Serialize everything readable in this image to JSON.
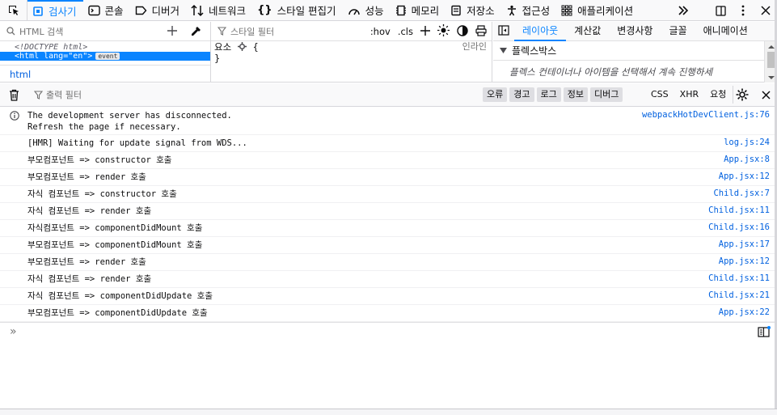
{
  "toolbar": {
    "tabs": [
      {
        "label": "검사기",
        "icon": "inspector-icon"
      },
      {
        "label": "콘솔",
        "icon": "console-icon"
      },
      {
        "label": "디버거",
        "icon": "debugger-icon"
      },
      {
        "label": "네트워크",
        "icon": "network-icon"
      },
      {
        "label": "스타일 편집기",
        "icon": "style-editor-icon"
      },
      {
        "label": "성능",
        "icon": "performance-icon"
      },
      {
        "label": "메모리",
        "icon": "memory-icon"
      },
      {
        "label": "저장소",
        "icon": "storage-icon"
      },
      {
        "label": "접근성",
        "icon": "accessibility-icon"
      },
      {
        "label": "애플리케이션",
        "icon": "application-icon"
      }
    ],
    "selected_tab": "검사기",
    "accent": "#0a84ff"
  },
  "markup": {
    "search_placeholder": "HTML 검색",
    "doctype": "<!DOCTYPE html>",
    "selected_node": "<html lang=\"en\">",
    "selected_badge": "event",
    "breadcrumb": "html"
  },
  "rules": {
    "filter_placeholder": "스타일 필터",
    "hov": ":hov",
    "cls": ".cls",
    "selector_line": "요소",
    "open_brace": "{",
    "close_brace": "}",
    "source": "인라인"
  },
  "layout": {
    "tabs": [
      "레이아웃",
      "계산값",
      "변경사항",
      "글꼴",
      "애니메이션"
    ],
    "selected_tab": "레이아웃",
    "flex_header": "플렉스박스",
    "flex_message": "플렉스 컨테이너나 아이템을 선택해서 계속 진행하세"
  },
  "console": {
    "filter_placeholder": "출력 필터",
    "levels": [
      "오류",
      "경고",
      "로그",
      "정보",
      "디버그"
    ],
    "requests": [
      "CSS",
      "XHR",
      "요청"
    ],
    "messages": [
      {
        "text": "The development server has disconnected.\nRefresh the page if necessary.",
        "location": "webpackHotDevClient.js:76",
        "type": "info"
      },
      {
        "text": "[HMR] Waiting for update signal from WDS...",
        "location": "log.js:24",
        "type": "log"
      },
      {
        "text": "부모컴포넌트 => constructor 호출",
        "location": "App.jsx:8",
        "type": "log"
      },
      {
        "text": "부모컴포넌트 => render 호출",
        "location": "App.jsx:12",
        "type": "log"
      },
      {
        "text": "자식 컴포넌트 => constructor 호출",
        "location": "Child.jsx:7",
        "type": "log"
      },
      {
        "text": "자식 컴포넌트 => render 호출",
        "location": "Child.jsx:11",
        "type": "log"
      },
      {
        "text": "자식컴포넌트 => componentDidMount 호출",
        "location": "Child.jsx:16",
        "type": "log"
      },
      {
        "text": "부모컴포넌트 => componentDidMount 호출",
        "location": "App.jsx:17",
        "type": "log"
      },
      {
        "text": "부모컴포넌트 => render 호출",
        "location": "App.jsx:12",
        "type": "log"
      },
      {
        "text": "자식 컴포넌트 => render 호출",
        "location": "Child.jsx:11",
        "type": "log"
      },
      {
        "text": "자식 컴포넌트 => componentDidUpdate 호출",
        "location": "Child.jsx:21",
        "type": "log"
      },
      {
        "text": "부모컴포넌트 => componentDidUpdate 호출",
        "location": "App.jsx:22",
        "type": "log"
      }
    ],
    "prompt": "»"
  }
}
